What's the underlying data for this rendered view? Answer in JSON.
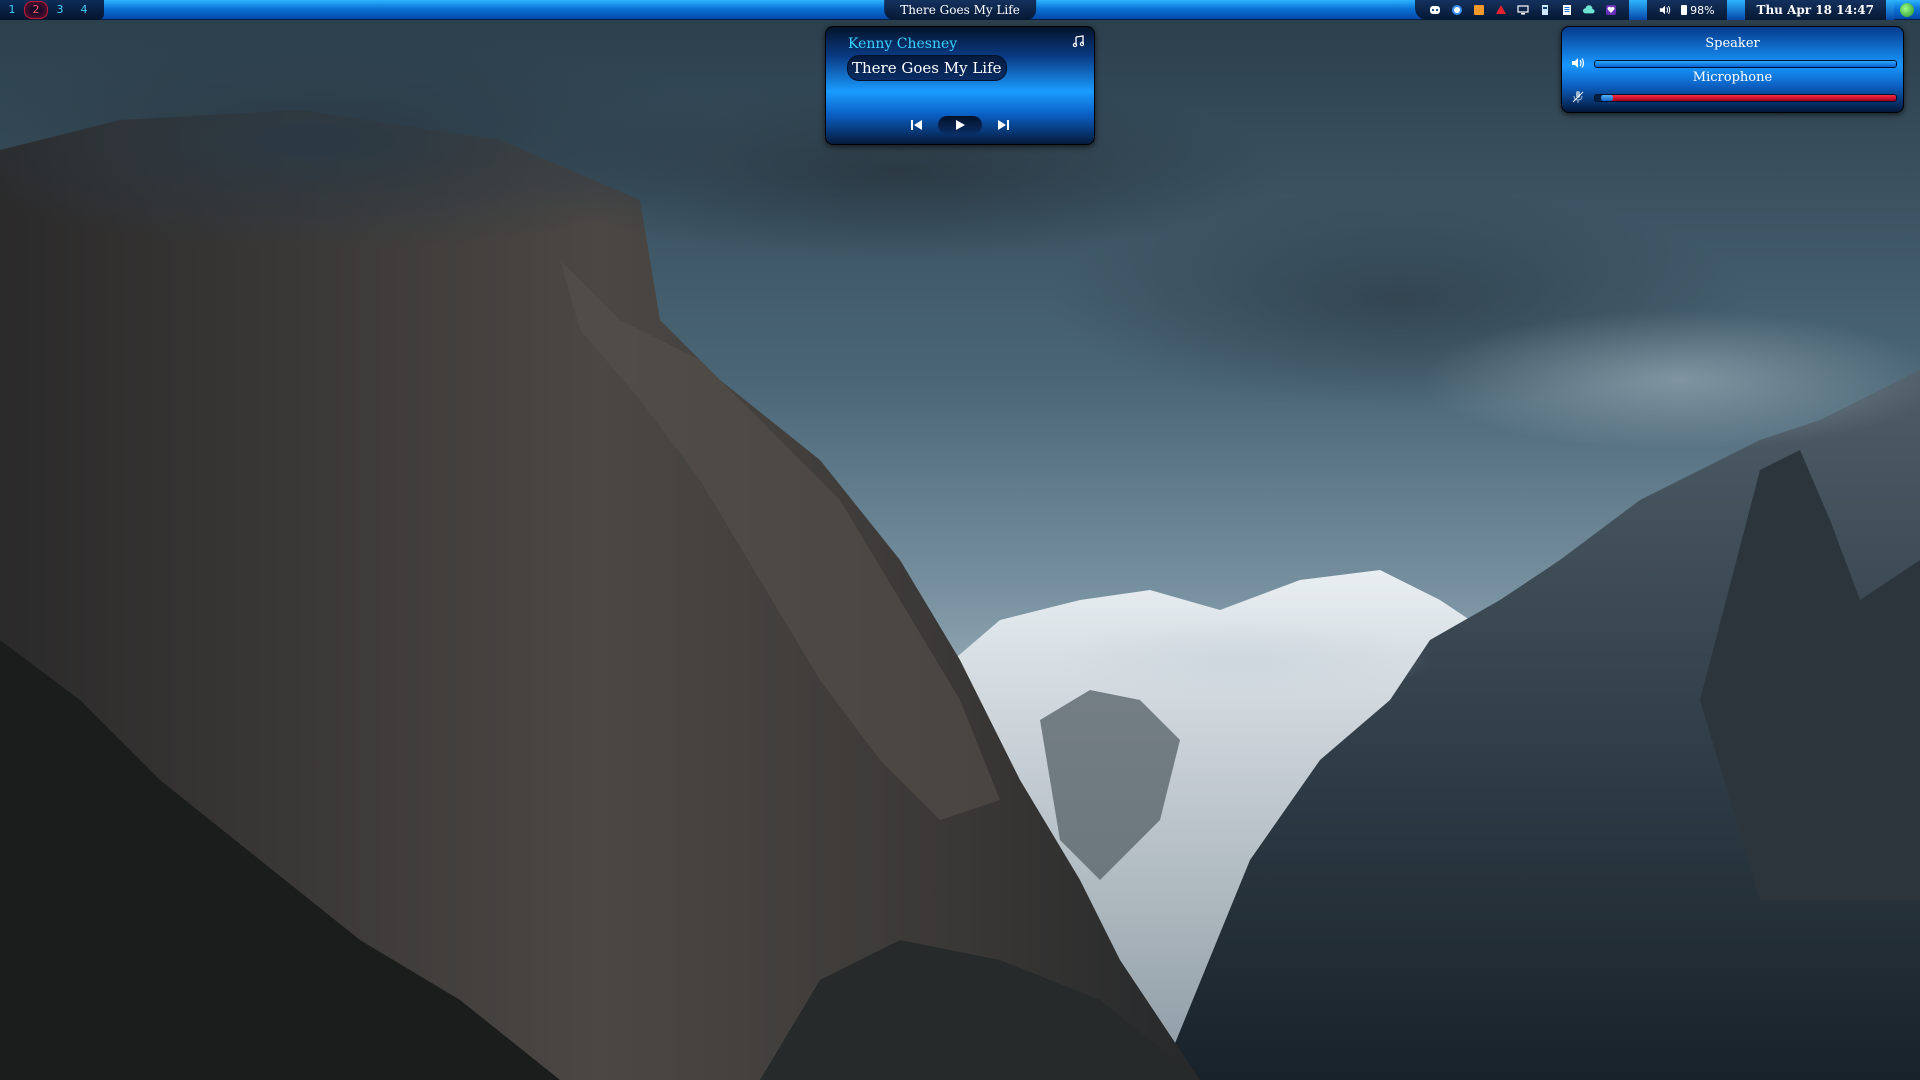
{
  "topbar": {
    "tags": [
      {
        "label": "1",
        "active": false
      },
      {
        "label": "2",
        "active": true
      },
      {
        "label": "3",
        "active": false
      },
      {
        "label": "4",
        "active": false
      }
    ],
    "window_title": "There Goes My Life",
    "tray_icons": [
      "discord-icon",
      "blue-circle-icon",
      "orange-square-icon",
      "red-alert-icon",
      "display-icon",
      "tray-app-icon",
      "document-icon",
      "cloud-icon",
      "heart-icon",
      "network-icon",
      "volume-icon"
    ],
    "battery": "98%",
    "clock": "Thu Apr 18 14:47"
  },
  "music": {
    "artist": "Kenny Chesney",
    "track": "There Goes My Life"
  },
  "volume": {
    "speaker_label": "Speaker",
    "microphone_label": "Microphone",
    "speaker_level": 1.0,
    "microphone_level": 0.04,
    "microphone_muted": true
  },
  "colors": {
    "accent": "#0a74d8",
    "artist_text": "#39d3ff",
    "mic_fill": "#e00022",
    "active_tag": "#ff5566"
  }
}
